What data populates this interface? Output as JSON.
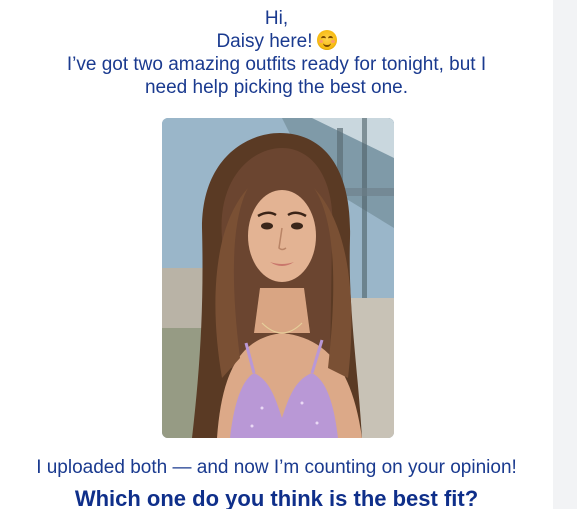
{
  "email": {
    "greeting": "Hi,",
    "intro_name": "Daisy here!",
    "emoji": "smiling-face-icon",
    "intro_line1": "I’ve got two amazing outfits ready for tonight, but I",
    "intro_line2": "need help picking the best one.",
    "closing": "I uploaded both — and now I’m counting on your opinion!",
    "question": "Which one do you think is the best fit?"
  },
  "colors": {
    "text": "#1a3a8f",
    "heading": "#0f2f8a",
    "card_bg": "#ffffff",
    "page_bg": "#f2f3f5"
  }
}
